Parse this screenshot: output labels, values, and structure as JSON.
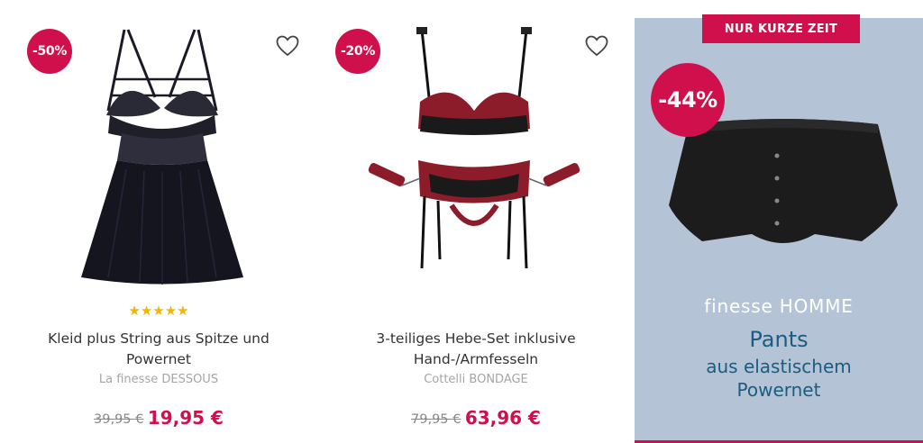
{
  "products": [
    {
      "badge": "-50%",
      "stars": "★★★★★",
      "title": "Kleid plus String aus Spitze und Powernet",
      "brand": "La finesse DESSOUS",
      "old_price": "39,95 €",
      "new_price": "19,95 €"
    },
    {
      "badge": "-20%",
      "title": "3-teiliges Hebe-Set inklusive Hand-/Armfesseln",
      "brand": "Cottelli BONDAGE",
      "old_price": "79,95 €",
      "new_price": "63,96 €"
    }
  ],
  "promo": {
    "banner": "NUR KURZE ZEIT",
    "badge": "-44%",
    "brand": "finesse HOMME",
    "line1": "Pants",
    "line2": "aus elastischem",
    "line3": "Powernet"
  },
  "colors": {
    "accent": "#d0104c",
    "promo_bg": "#b4c4d6",
    "promo_text": "#1a5d80",
    "stars": "#f2b600"
  },
  "icons": {
    "wishlist": "heart-outline-icon",
    "rating": "star-icon"
  }
}
